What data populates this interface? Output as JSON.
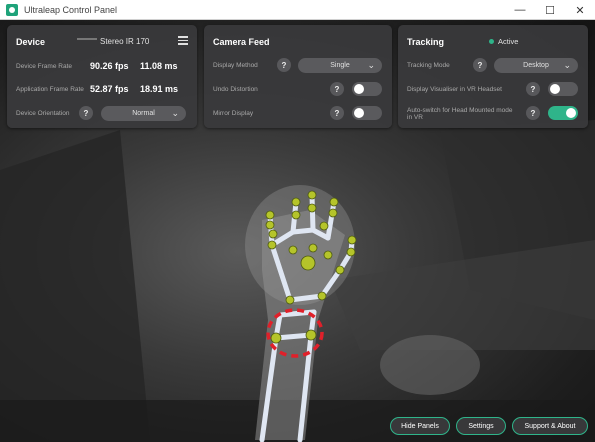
{
  "window": {
    "title": "Ultraleap Control Panel",
    "minimize_symbol": "—",
    "maximize_symbol": "☐",
    "close_symbol": "✕"
  },
  "device": {
    "title": "Device",
    "model": "Stereo IR 170",
    "frame_rate_label": "Device Frame Rate",
    "frame_rate_fps": "90.26 fps",
    "frame_rate_ms": "11.08 ms",
    "app_frame_rate_label": "Application Frame Rate",
    "app_frame_rate_fps": "52.87 fps",
    "app_frame_rate_ms": "18.91 ms",
    "orientation_label": "Device Orientation",
    "orientation_value": "Normal"
  },
  "camera_feed": {
    "title": "Camera Feed",
    "display_method_label": "Display Method",
    "display_method_value": "Single",
    "undo_distortion_label": "Undo Distortion",
    "undo_distortion_on": false,
    "mirror_display_label": "Mirror Display",
    "mirror_display_on": false
  },
  "tracking": {
    "title": "Tracking",
    "status": "Active",
    "mode_label": "Tracking Mode",
    "mode_value": "Desktop",
    "visualiser_label": "Display Visualiser in VR Headset",
    "visualiser_on": false,
    "auto_switch_label": "Auto-switch for Head Mounted mode in VR",
    "auto_switch_on": true
  },
  "help_symbol": "?",
  "dropdown_chevron": "⌄",
  "bottom_buttons": {
    "hide_panels": "Hide Panels",
    "settings": "Settings",
    "support": "Support & About"
  },
  "colors": {
    "accent": "#2fb48a",
    "panel_bg": "#3a3a3c",
    "skeleton_joint": "#b5c42a",
    "skeleton_bone": "#dfe6f2",
    "highlight_circle": "#e0202a"
  }
}
